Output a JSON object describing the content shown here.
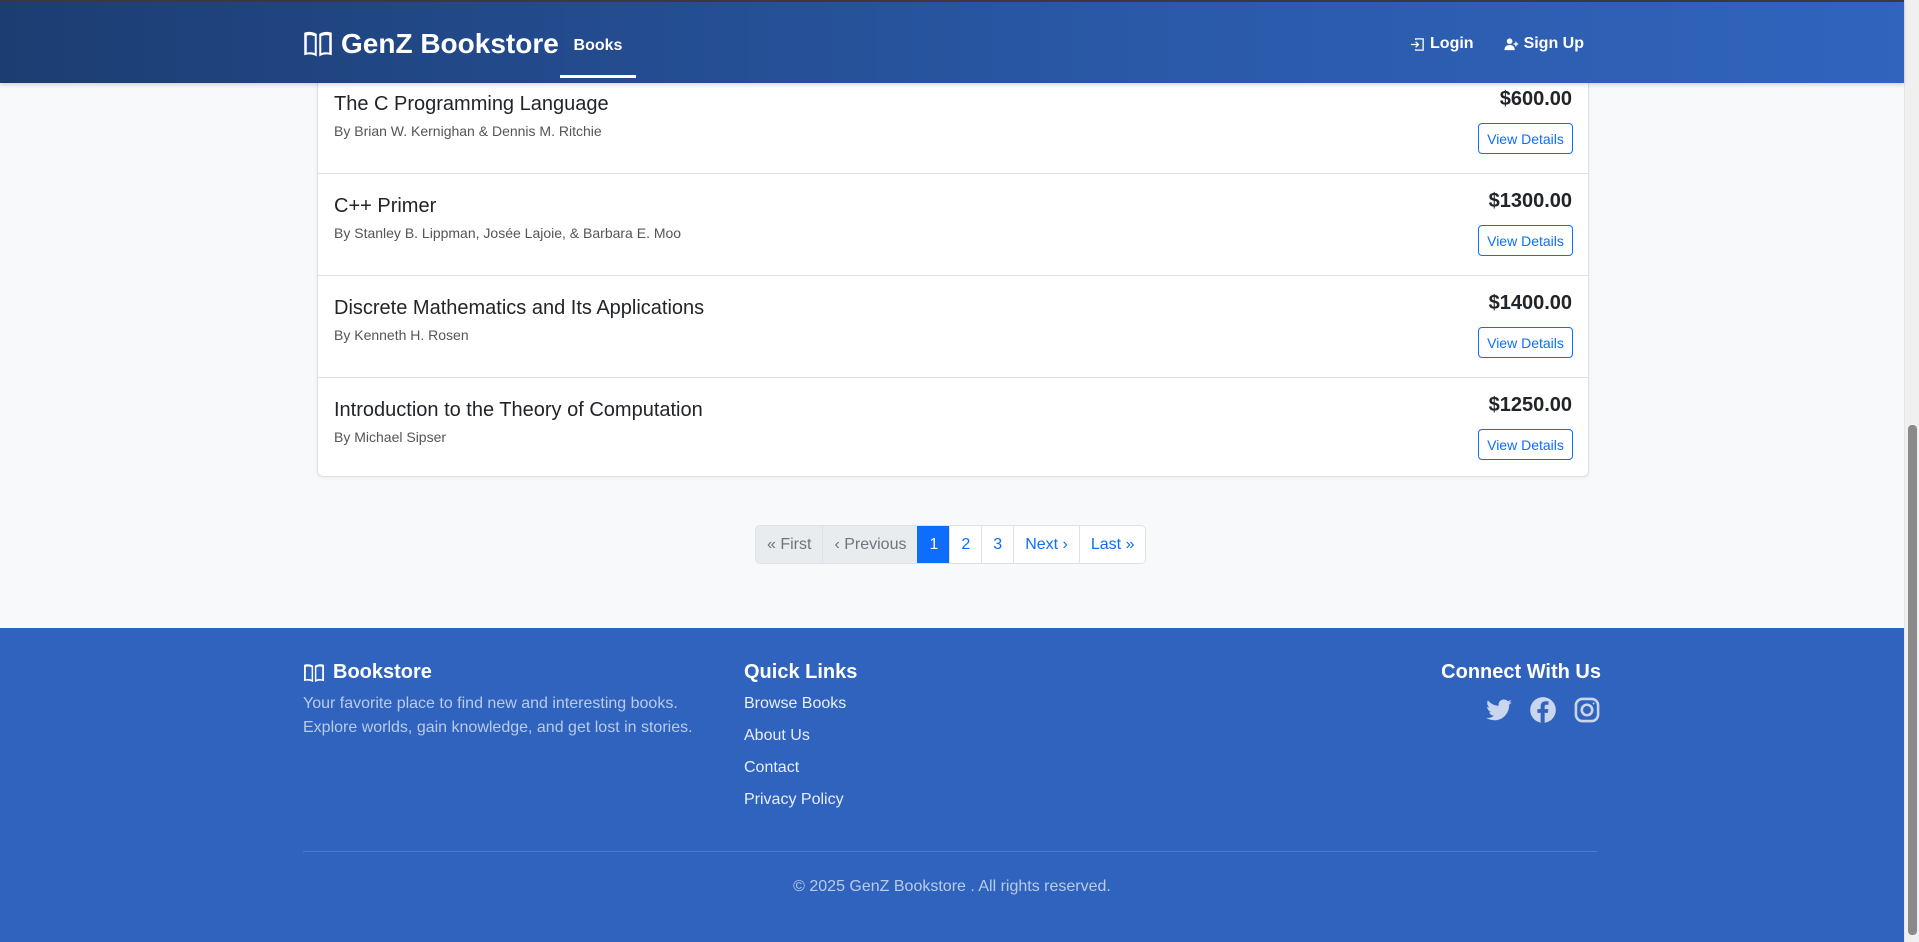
{
  "navbar": {
    "brand": "GenZ Bookstore",
    "brand_icon": "open-book-icon",
    "books_label": "Books",
    "login_label": "Login",
    "signup_label": "Sign Up"
  },
  "books": [
    {
      "title": "The C Programming Language",
      "author": "By Brian W. Kernighan & Dennis M. Ritchie",
      "price": "$600.00",
      "button": "View Details"
    },
    {
      "title": "C++ Primer",
      "author": "By Stanley B. Lippman, Josée Lajoie, & Barbara E. Moo",
      "price": "$1300.00",
      "button": "View Details"
    },
    {
      "title": "Discrete Mathematics and Its Applications",
      "author": "By Kenneth H. Rosen",
      "price": "$1400.00",
      "button": "View Details"
    },
    {
      "title": "Introduction to the Theory of Computation",
      "author": "By Michael Sipser",
      "price": "$1250.00",
      "button": "View Details"
    }
  ],
  "pagination": {
    "first": "« First",
    "previous": "‹ Previous",
    "pages": [
      "1",
      "2",
      "3"
    ],
    "current": "1",
    "next": "Next ›",
    "last": "Last »"
  },
  "footer": {
    "brand": "Bookstore",
    "description_line1": "Your favorite place to find new and interesting books.",
    "description_line2": "Explore worlds, gain knowledge, and get lost in stories.",
    "quick_links_title": "Quick Links",
    "quick_links": [
      "Browse Books",
      "About Us",
      "Contact",
      "Privacy Policy"
    ],
    "connect_title": "Connect With Us",
    "social_icons": [
      "twitter-icon",
      "facebook-icon",
      "instagram-icon"
    ],
    "copyright": "© 2025 GenZ Bookstore . All rights reserved."
  },
  "colors": {
    "primary": "#0d6efd",
    "footer_bg": "#3063bd",
    "navbar_start": "#1c3d72",
    "navbar_end": "#3064bd"
  }
}
